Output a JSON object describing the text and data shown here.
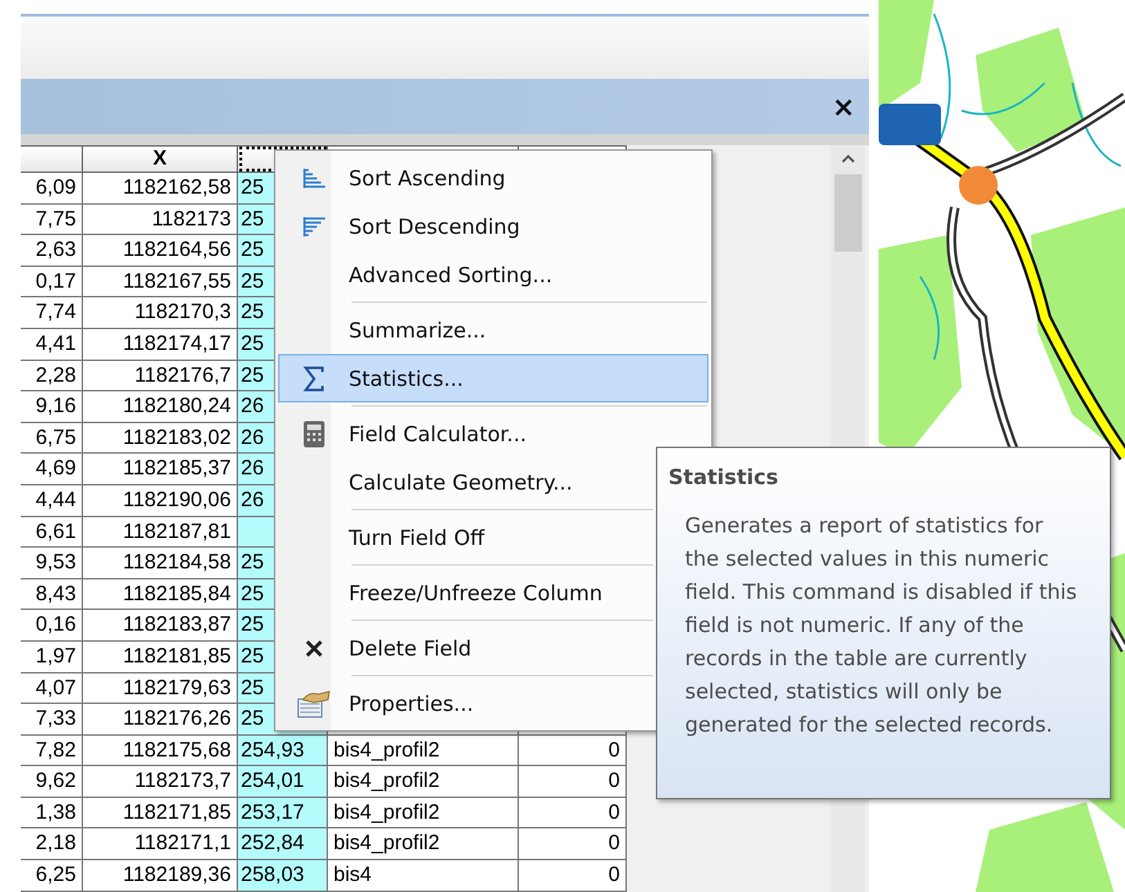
{
  "window": {
    "close": "×"
  },
  "table": {
    "columns": [
      {
        "selected": false
      },
      {
        "header": "X",
        "selected": false
      },
      {
        "selected": true
      }
    ],
    "rows": [
      {
        "cells": [
          "6,09",
          "1182162,58",
          "25"
        ]
      },
      {
        "cells": [
          "7,75",
          "1182173",
          "25"
        ]
      },
      {
        "cells": [
          "2,63",
          "1182164,56",
          "25"
        ]
      },
      {
        "cells": [
          "0,17",
          "1182167,55",
          "25"
        ]
      },
      {
        "cells": [
          "7,74",
          "1182170,3",
          "25"
        ]
      },
      {
        "cells": [
          "4,41",
          "1182174,17",
          "25"
        ]
      },
      {
        "cells": [
          "2,28",
          "1182176,7",
          "25"
        ]
      },
      {
        "cells": [
          "9,16",
          "1182180,24",
          "26"
        ]
      },
      {
        "cells": [
          "6,75",
          "1182183,02",
          "26"
        ]
      },
      {
        "cells": [
          "4,69",
          "1182185,37",
          "26"
        ]
      },
      {
        "cells": [
          "4,44",
          "1182190,06",
          "26"
        ]
      },
      {
        "cells": [
          "6,61",
          "1182187,81"
        ]
      },
      {
        "cells": [
          "9,53",
          "1182184,58",
          "25"
        ]
      },
      {
        "cells": [
          "8,43",
          "1182185,84",
          "25"
        ]
      },
      {
        "cells": [
          "0,16",
          "1182183,87",
          "25"
        ]
      },
      {
        "cells": [
          "1,97",
          "1182181,85",
          "25"
        ]
      },
      {
        "cells": [
          "4,07",
          "1182179,63",
          "25"
        ]
      },
      {
        "cells": [
          "7,33",
          "1182176,26",
          "25"
        ]
      },
      {
        "cells": [
          "7,82",
          "1182175,68",
          "254,93",
          "bis4_profil2",
          "0"
        ]
      },
      {
        "cells": [
          "9,62",
          "1182173,7",
          "254,01",
          "bis4_profil2",
          "0"
        ]
      },
      {
        "cells": [
          "1,38",
          "1182171,85",
          "253,17",
          "bis4_profil2",
          "0"
        ]
      },
      {
        "cells": [
          "2,18",
          "1182171,1",
          "252,84",
          "bis4_profil2",
          "0"
        ]
      },
      {
        "cells": [
          "6,25",
          "1182189,36",
          "258,03",
          "bis4",
          "0"
        ]
      }
    ]
  },
  "context_menu": {
    "items": [
      {
        "label": "Sort Ascending",
        "kind": "sort-asc",
        "separator_before": false,
        "selected": false
      },
      {
        "label": "Sort Descending",
        "kind": "sort-desc",
        "separator_before": false,
        "selected": false
      },
      {
        "label": "Advanced Sorting...",
        "kind": "plain",
        "separator_before": false,
        "selected": false
      },
      {
        "label": "Summarize...",
        "kind": "plain",
        "separator_before": true,
        "selected": false
      },
      {
        "label": "Statistics...",
        "kind": "sigma",
        "separator_before": false,
        "selected": true
      },
      {
        "label": "Field Calculator...",
        "kind": "calculator",
        "separator_before": true,
        "selected": false
      },
      {
        "label": "Calculate Geometry...",
        "kind": "plain",
        "separator_before": false,
        "selected": false
      },
      {
        "label": "Turn Field Off",
        "kind": "plain",
        "separator_before": true,
        "selected": false
      },
      {
        "label": "Freeze/Unfreeze Column",
        "kind": "plain",
        "separator_before": true,
        "selected": false
      },
      {
        "label": "Delete Field",
        "kind": "delete",
        "separator_before": true,
        "selected": false
      },
      {
        "label": "Properties...",
        "kind": "properties",
        "separator_before": true,
        "selected": false
      }
    ]
  },
  "tooltip": {
    "title": "Statistics",
    "text": "Generates a report of statistics for the selected values in this numeric field. This command is disabled if this field is not numeric. If any of the records in the table are currently selected, statistics will only be generated for the selected records."
  }
}
